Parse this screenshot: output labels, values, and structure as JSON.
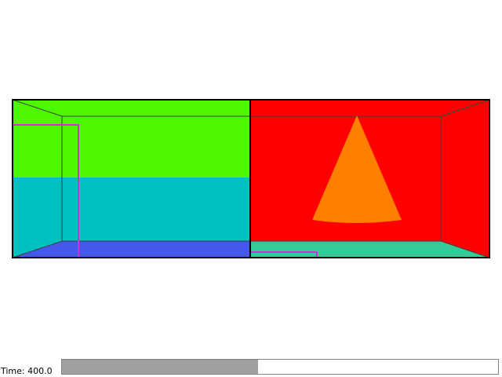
{
  "simulation": {
    "time_label": "Time: 400.0",
    "time_progress": 0.45
  },
  "colors": {
    "background": "#ffffff",
    "left_room_upper_wall": "#4cf700",
    "left_room_lower_wall": "#00c0c0",
    "left_room_floor": "#4458ec",
    "right_room_wall": "#ff0000",
    "right_room_floor": "#33cc99",
    "cone": "#ff8000",
    "path_line": "#cc33cc",
    "frame_outline": "#000000",
    "edge_line": "#404040",
    "progress_fill": "#a0a0a0",
    "progress_track": "#ffffff"
  },
  "icons": {
    "cone": "cone-shape",
    "path": "trajectory-line"
  }
}
